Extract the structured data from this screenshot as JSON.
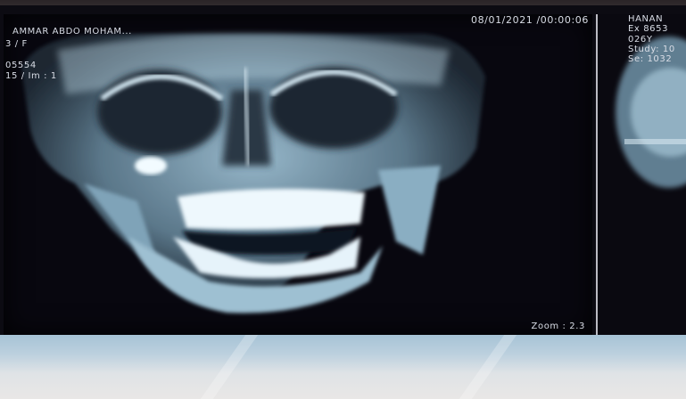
{
  "left_image": {
    "patient_name": "AMMAR    ABDO  MOHAM...",
    "sex": "3 / F",
    "patient_id": "05554",
    "series_image": "15 / Im : 1",
    "study_datetime": "08/01/2021 /00:00:06",
    "zoom": "Zoom : 2.3"
  },
  "right_image": {
    "patient_name": "HANAN",
    "exam": "Ex  8653",
    "age": "026Y",
    "study": "Study: 10",
    "series": "Se:  1032"
  },
  "scene": {
    "subject": "skull-xray",
    "film_background": "#08070f",
    "bone_color": "#e4f2fa",
    "table_color": "#bcd0de"
  }
}
